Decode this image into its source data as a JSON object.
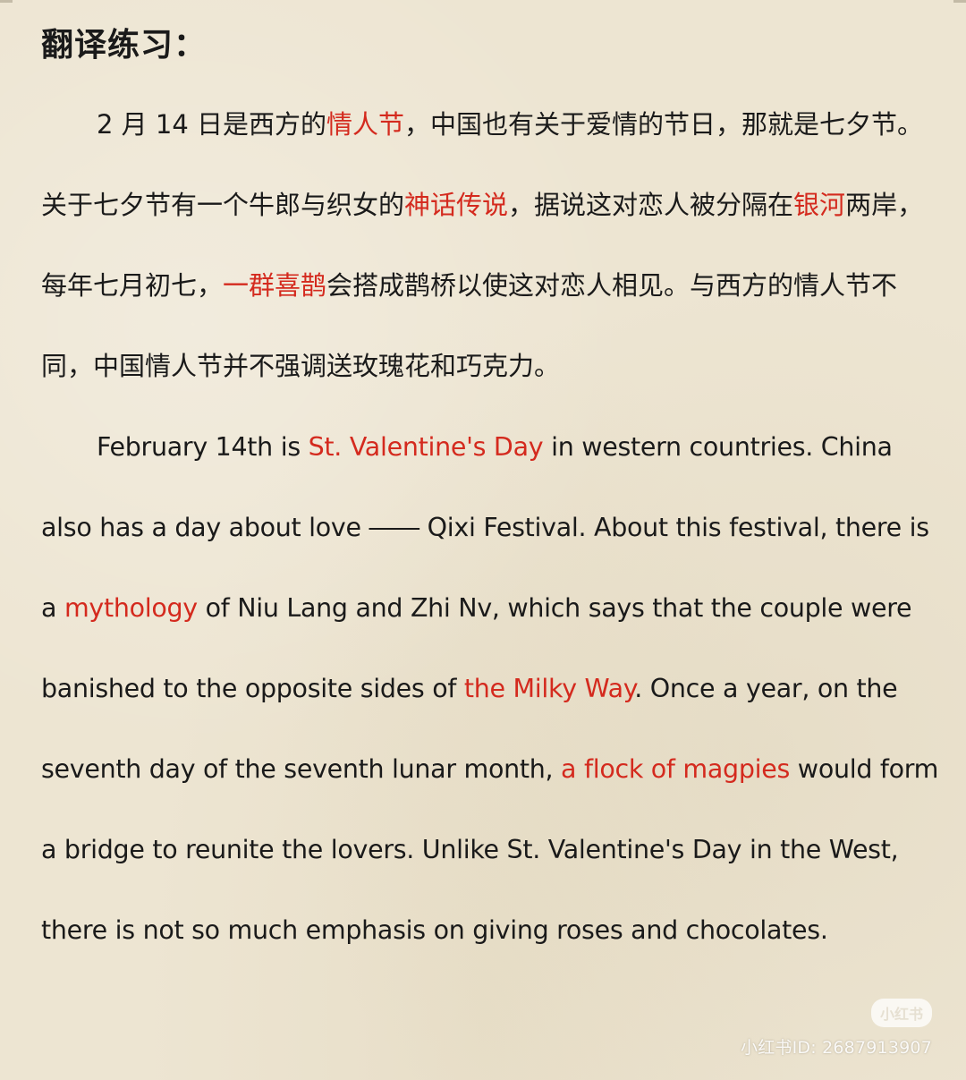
{
  "title": "翻译练习：",
  "chinese": {
    "s1": "2 月 14 日是西方的",
    "h1": "情人节",
    "s2": "，中国也有关于爱情的节日，那就是七夕节。关于七夕节有一个牛郎与织女的",
    "h2": "神话传说",
    "s3": "，据说这对恋人被分隔在",
    "h3": "银河",
    "s4": "两岸，每年七月初七，",
    "h4": "一群喜鹊",
    "s5": "会搭成鹊桥以使这对恋人相见。与西方的情人节不同，中国情人节并不强调送玫瑰花和巧克力。"
  },
  "english": {
    "s1": "February 14th is ",
    "h1": "St. Valentine's Day",
    "s2": " in western countries. China also has a day about love ―― Qixi Festival. About this festival, there is a ",
    "h2": "mythology",
    "s3": " of Niu Lang and Zhi Nv, which says that the couple were banished to the opposite sides of ",
    "h3": "the Milky Way",
    "s4": ". Once a year, on the seventh day of the seventh lunar month, ",
    "h4": "a flock of magpies",
    "s5": " would form a bridge to reunite the lovers. Unlike St. Valentine's Day in the West, there is not so much emphasis on giving roses and chocolates."
  },
  "watermark": {
    "logo": "小红书",
    "id_text": "小红书ID: 2687913907"
  },
  "colors": {
    "highlight": "#d42a1e",
    "text": "#1a1a1a",
    "paper": "#ede5d2"
  }
}
